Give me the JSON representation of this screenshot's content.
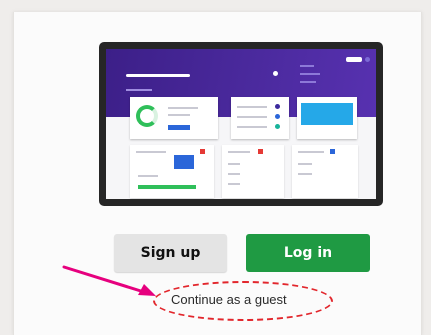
{
  "actions": {
    "signup_label": "Sign up",
    "login_label": "Log in",
    "guest_label": "Continue as a guest"
  },
  "illustration": {
    "icon": "dashboard-preview-illustration"
  },
  "annotation": {
    "arrow_icon": "pointer-arrow-icon",
    "highlight_icon": "dashed-ellipse-highlight",
    "color": "#e2262c",
    "arrow_color": "#e6007e"
  },
  "colors": {
    "login_button": "#1f9a43",
    "signup_button": "#e4e4e4",
    "dashboard_header": "#4b2a9e"
  }
}
